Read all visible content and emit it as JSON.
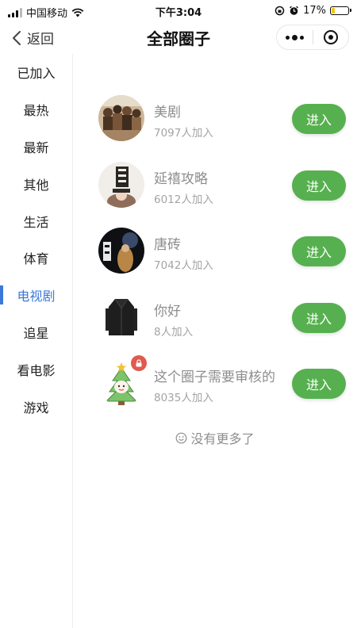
{
  "status_bar": {
    "carrier": "中国移动",
    "time": "下午3:04",
    "battery": "17%",
    "battery_level": 0.17,
    "battery_color": "#f5c518",
    "icons": [
      "signal-icon",
      "wifi-icon",
      "orientation-lock-icon",
      "alarm-icon",
      "battery-icon"
    ]
  },
  "nav": {
    "back_label": "返回",
    "title": "全部圈子",
    "more_icon": "more-dots-icon",
    "close_icon": "target-close-icon"
  },
  "sidebar": {
    "active_index": 6,
    "active_color": "#3b78d8",
    "items": [
      {
        "label": "已加入"
      },
      {
        "label": "最热"
      },
      {
        "label": "最新"
      },
      {
        "label": "其他"
      },
      {
        "label": "生活"
      },
      {
        "label": "体育"
      },
      {
        "label": "电视剧"
      },
      {
        "label": "追星"
      },
      {
        "label": "看电影"
      },
      {
        "label": "游戏"
      }
    ]
  },
  "circles": [
    {
      "name": "美剧",
      "members": "7097人加入",
      "button": "进入",
      "avatar": "group-photo-avatar",
      "locked": false
    },
    {
      "name": "延禧攻略",
      "members": "6012人加入",
      "button": "进入",
      "avatar": "drama-poster-avatar",
      "locked": false
    },
    {
      "name": "唐砖",
      "members": "7042人加入",
      "button": "进入",
      "avatar": "dark-poster-avatar",
      "locked": false
    },
    {
      "name": "你好",
      "members": "8人加入",
      "button": "进入",
      "avatar": "coat-avatar",
      "locked": false
    },
    {
      "name": "这个圈子需要审核的",
      "members": "8035人加入",
      "button": "进入",
      "avatar": "christmas-tree-avatar",
      "locked": true
    }
  ],
  "button_color": "#57b04f",
  "footer": {
    "text": "没有更多了",
    "icon": "smile-icon"
  }
}
